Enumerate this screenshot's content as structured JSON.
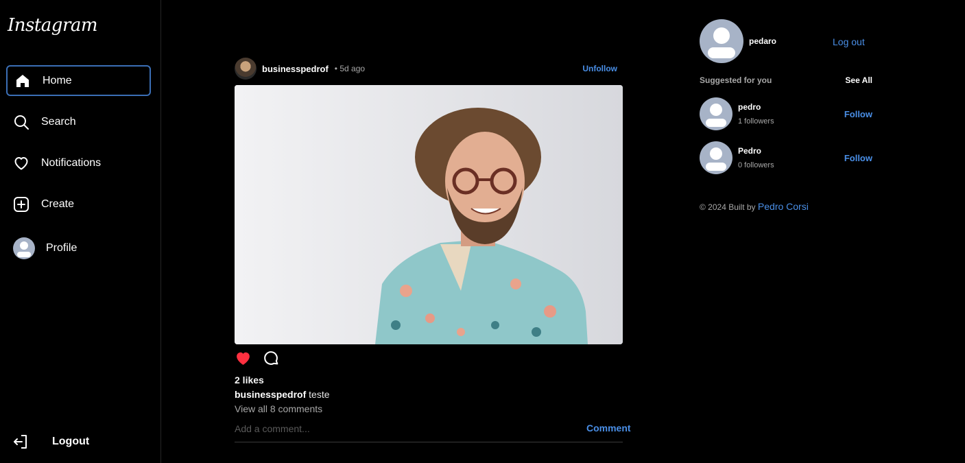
{
  "app": {
    "logo": "Instagram"
  },
  "sidebar": {
    "items": [
      {
        "label": "Home",
        "icon": "home-icon"
      },
      {
        "label": "Search",
        "icon": "search-icon"
      },
      {
        "label": "Notifications",
        "icon": "heart-icon"
      },
      {
        "label": "Create",
        "icon": "plus-square-icon"
      },
      {
        "label": "Profile",
        "icon": "avatar"
      }
    ],
    "logout_label": "Logout"
  },
  "post": {
    "username": "businesspedrof",
    "time": "• 5d ago",
    "unfollow_label": "Unfollow",
    "likes": "2 likes",
    "caption_user": "businesspedrof",
    "caption_text": "teste",
    "view_comments": "View all 8 comments",
    "comment_placeholder": "Add a comment...",
    "comment_button": "Comment",
    "liked_color": "#ff3040"
  },
  "right": {
    "username": "pedaro",
    "logout_label": "Log out",
    "suggested_label": "Suggested for you",
    "see_all_label": "See All",
    "suggestions": [
      {
        "name": "pedro",
        "followers": "1 followers",
        "action": "Follow"
      },
      {
        "name": "Pedro",
        "followers": "0 followers",
        "action": "Follow"
      }
    ],
    "footer_text": "© 2024 Built by",
    "footer_link": "Pedro Corsi"
  },
  "colors": {
    "accent": "#4a8fe7",
    "active_border": "#3b6fb6",
    "avatar_bg": "#a7b3c7"
  }
}
